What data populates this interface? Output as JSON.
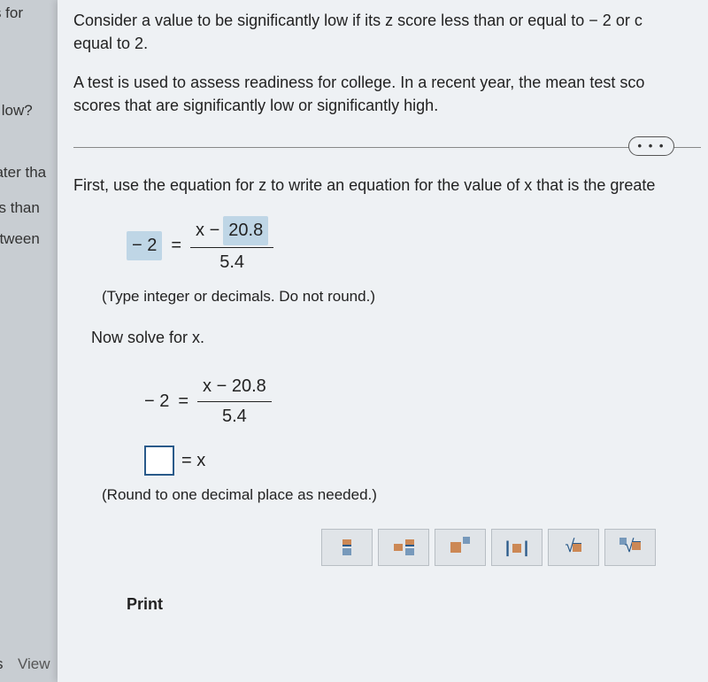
{
  "background": {
    "text1": "ess for",
    "text2": "tly low?",
    "text3": "eater tha",
    "text4": "ss than",
    "text5": "etween",
    "text6_s": "s",
    "text6": "View"
  },
  "intro": {
    "line1": "Consider a value to be significantly low if its z score less than or equal to − 2 or c",
    "line2": "equal to 2."
  },
  "problem": {
    "line1": "A test is used to assess readiness for college. In a recent year, the mean test sco",
    "line2": "scores that are significantly low or significantly high."
  },
  "more_label": "• • •",
  "instruction": "First, use the equation for z to write an equation for the value of x that is the greate",
  "equation1": {
    "lhs": "− 2",
    "x_label": "x −",
    "value": "20.8",
    "denom": "5.4"
  },
  "hint1": "(Type integer or decimals. Do not round.)",
  "solve_text": "Now solve for x.",
  "equation2": {
    "lhs": "− 2",
    "equals": "=",
    "num": "x − 20.8",
    "denom": "5.4"
  },
  "result": {
    "equals_x": "= x"
  },
  "hint2": "(Round to one decimal place as needed.)",
  "print": "Print"
}
